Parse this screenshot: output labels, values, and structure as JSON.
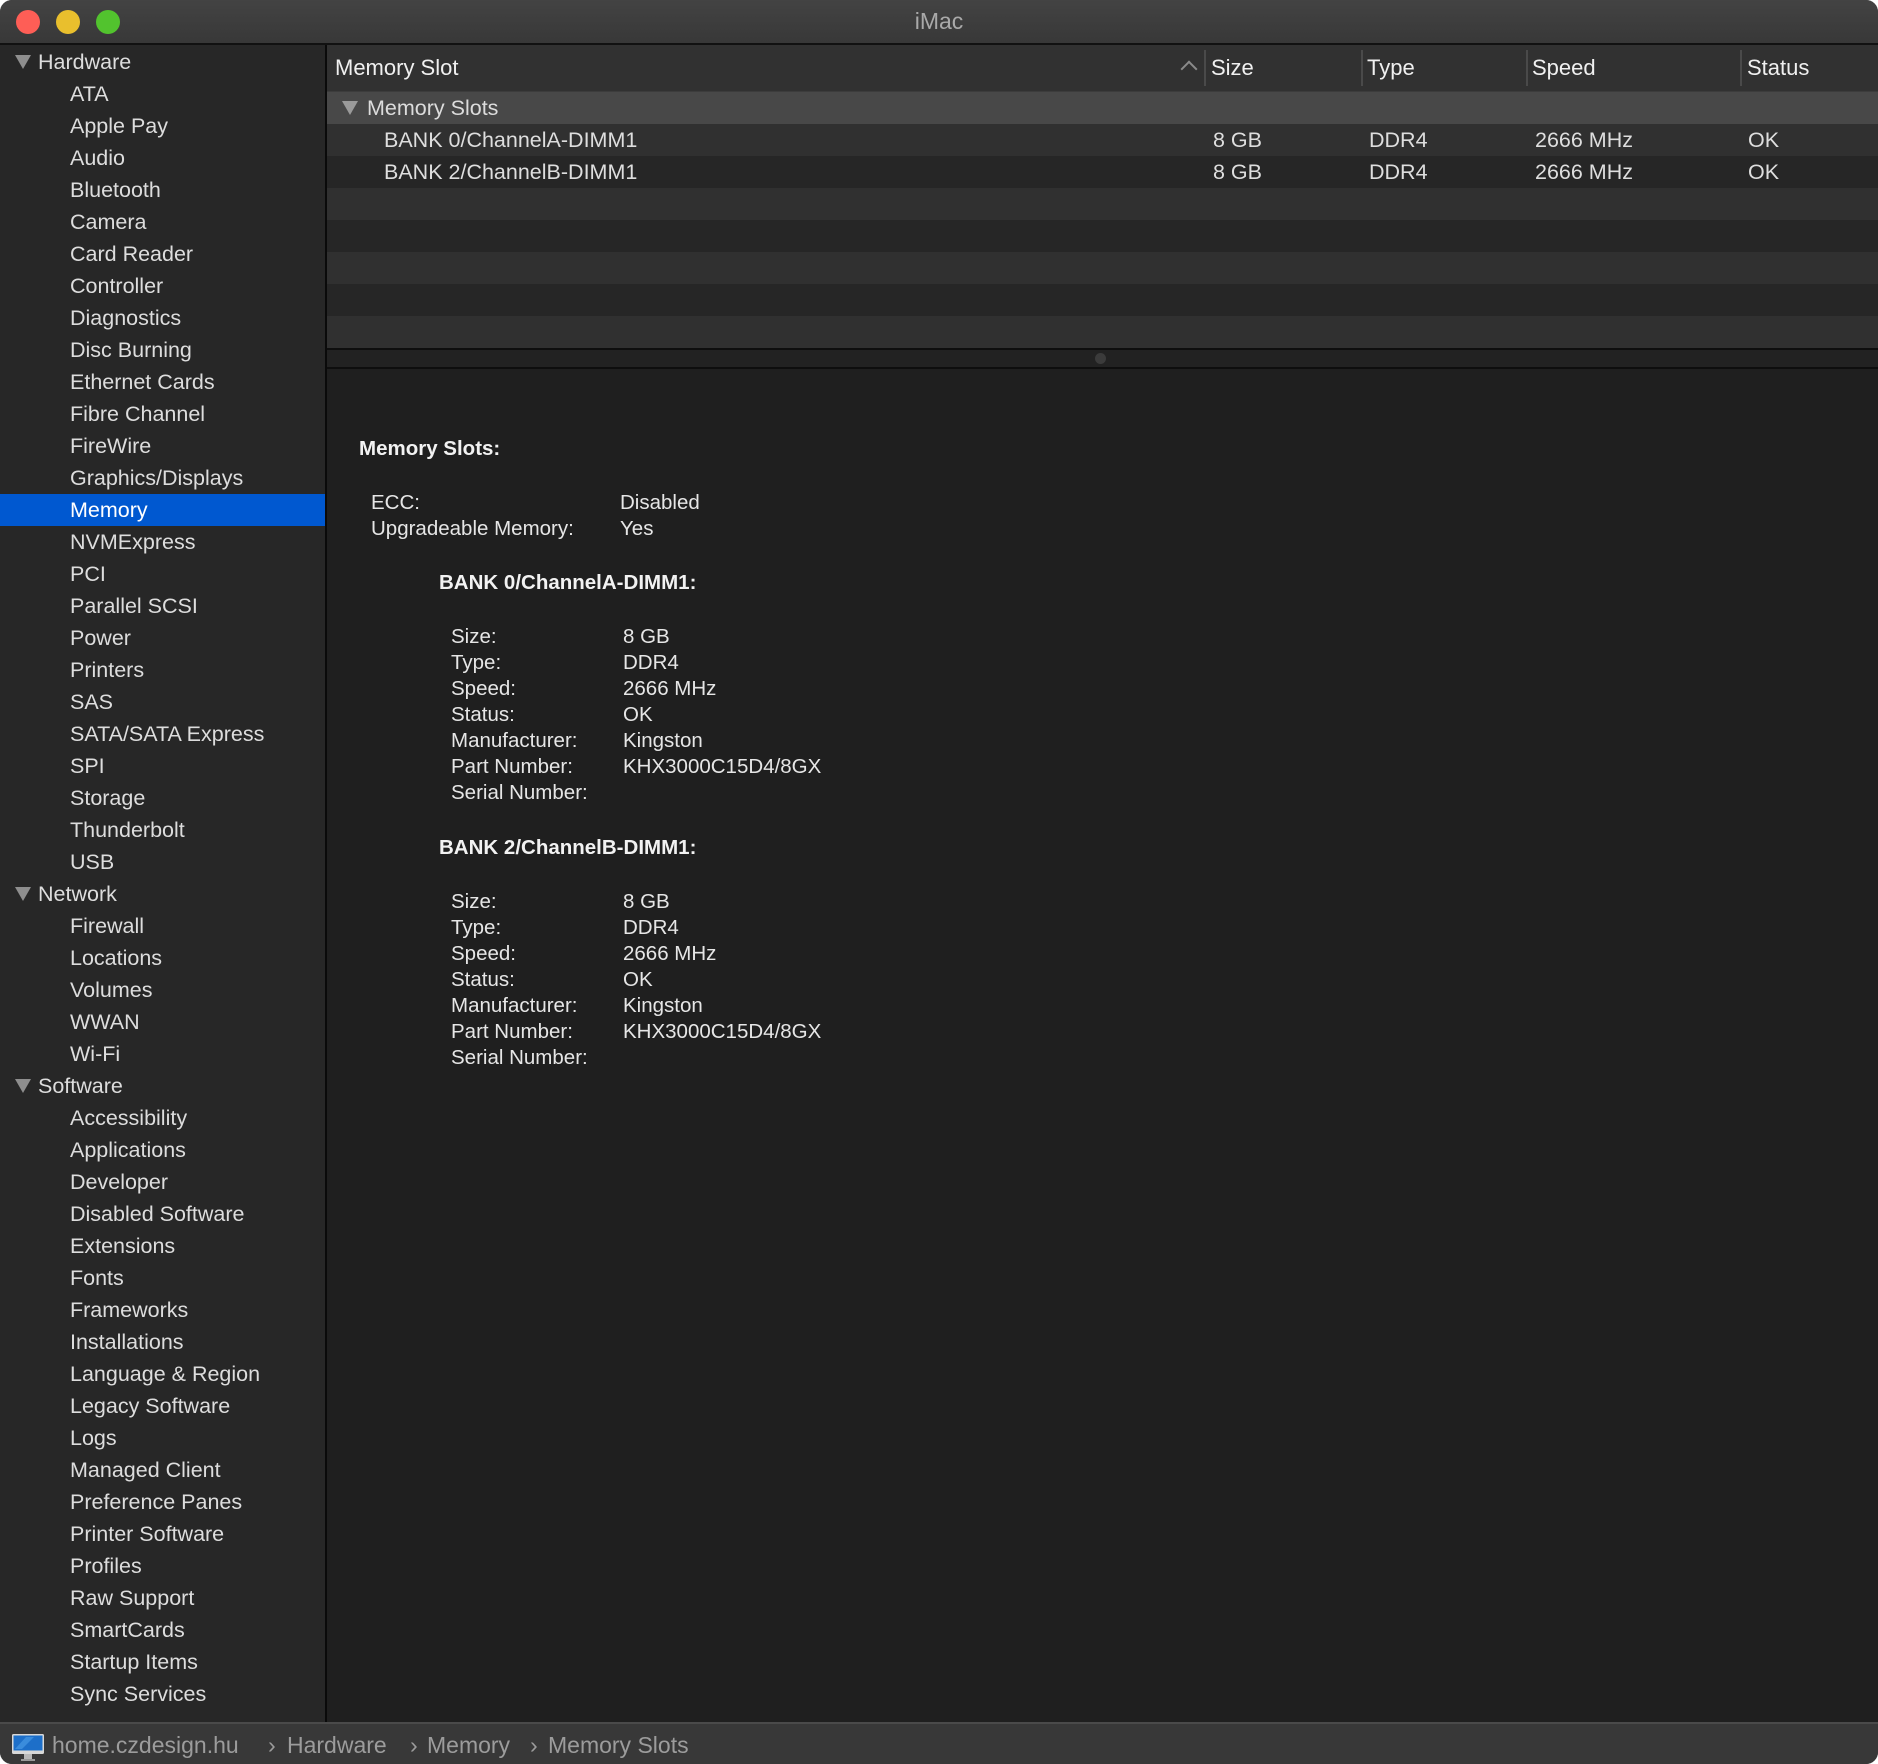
{
  "window": {
    "title": "iMac"
  },
  "sidebar": {
    "groups": [
      {
        "label": "Hardware",
        "items": [
          "ATA",
          "Apple Pay",
          "Audio",
          "Bluetooth",
          "Camera",
          "Card Reader",
          "Controller",
          "Diagnostics",
          "Disc Burning",
          "Ethernet Cards",
          "Fibre Channel",
          "FireWire",
          "Graphics/Displays",
          "Memory",
          "NVMExpress",
          "PCI",
          "Parallel SCSI",
          "Power",
          "Printers",
          "SAS",
          "SATA/SATA Express",
          "SPI",
          "Storage",
          "Thunderbolt",
          "USB"
        ]
      },
      {
        "label": "Network",
        "items": [
          "Firewall",
          "Locations",
          "Volumes",
          "WWAN",
          "Wi-Fi"
        ]
      },
      {
        "label": "Software",
        "items": [
          "Accessibility",
          "Applications",
          "Developer",
          "Disabled Software",
          "Extensions",
          "Fonts",
          "Frameworks",
          "Installations",
          "Language & Region",
          "Legacy Software",
          "Logs",
          "Managed Client",
          "Preference Panes",
          "Printer Software",
          "Profiles",
          "Raw Support",
          "SmartCards",
          "Startup Items",
          "Sync Services"
        ]
      }
    ],
    "selected": "Memory",
    "selected_color": "#0058d0"
  },
  "table": {
    "columns": [
      "Memory Slot",
      "Size",
      "Type",
      "Speed",
      "Status"
    ],
    "sort_column": "Memory Slot",
    "sort_direction": "ascending",
    "group": "Memory Slots",
    "rows": [
      {
        "slot": "BANK 0/ChannelA-DIMM1",
        "size": "8 GB",
        "type": "DDR4",
        "speed": "2666 MHz",
        "status": "OK"
      },
      {
        "slot": "BANK 2/ChannelB-DIMM1",
        "size": "8 GB",
        "type": "DDR4",
        "speed": "2666 MHz",
        "status": "OK"
      }
    ]
  },
  "detail": {
    "heading": "Memory Slots:",
    "summary": [
      {
        "label": "ECC:",
        "value": "Disabled"
      },
      {
        "label": "Upgradeable Memory:",
        "value": "Yes"
      }
    ],
    "banks": [
      {
        "heading": "BANK 0/ChannelA-DIMM1:",
        "fields": [
          {
            "label": "Size:",
            "value": "8 GB"
          },
          {
            "label": "Type:",
            "value": "DDR4"
          },
          {
            "label": "Speed:",
            "value": "2666 MHz"
          },
          {
            "label": "Status:",
            "value": "OK"
          },
          {
            "label": "Manufacturer:",
            "value": "Kingston"
          },
          {
            "label": "Part Number:",
            "value": "KHX3000C15D4/8GX"
          },
          {
            "label": "Serial Number:",
            "value": ""
          }
        ]
      },
      {
        "heading": "BANK 2/ChannelB-DIMM1:",
        "fields": [
          {
            "label": "Size:",
            "value": "8 GB"
          },
          {
            "label": "Type:",
            "value": "DDR4"
          },
          {
            "label": "Speed:",
            "value": "2666 MHz"
          },
          {
            "label": "Status:",
            "value": "OK"
          },
          {
            "label": "Manufacturer:",
            "value": "Kingston"
          },
          {
            "label": "Part Number:",
            "value": "KHX3000C15D4/8GX"
          },
          {
            "label": "Serial Number:",
            "value": ""
          }
        ]
      }
    ]
  },
  "breadcrumb": {
    "icon": "imac-icon",
    "items": [
      "home.czdesign.hu",
      "Hardware",
      "Memory",
      "Memory Slots"
    ],
    "separator": "›"
  }
}
